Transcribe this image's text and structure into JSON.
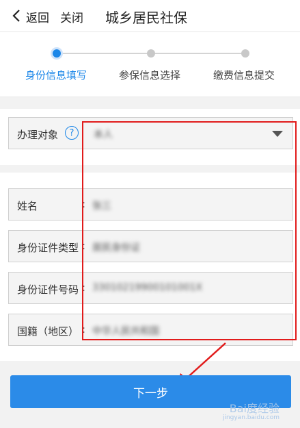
{
  "header": {
    "back_label": "返回",
    "close_label": "关闭",
    "title": "城乡居民社保"
  },
  "stepper": {
    "steps": [
      {
        "label": "身份信息填写",
        "active": true
      },
      {
        "label": "参保信息选择",
        "active": false
      },
      {
        "label": "缴费信息提交",
        "active": false
      }
    ]
  },
  "form": {
    "handle_target": {
      "label": "办理对象",
      "help": "?",
      "value": "本人"
    },
    "fields": [
      {
        "label": "姓名",
        "colon": ":",
        "value": "张三"
      },
      {
        "label": "身份证件类型",
        "colon": ":",
        "value": "居民身份证"
      },
      {
        "label": "身份证件号码",
        "colon": ":",
        "value": "33010219900101001X"
      },
      {
        "label": "国籍（地区）",
        "colon": ":",
        "value": "中华人民共和国"
      }
    ]
  },
  "button": {
    "next_label": "下一步"
  },
  "watermark": {
    "text": "Bai度经验",
    "sub": "jingyan.baidu.com"
  },
  "colors": {
    "accent": "#1a86e8",
    "annotation": "#e11b1b",
    "button": "#2b8be8"
  }
}
